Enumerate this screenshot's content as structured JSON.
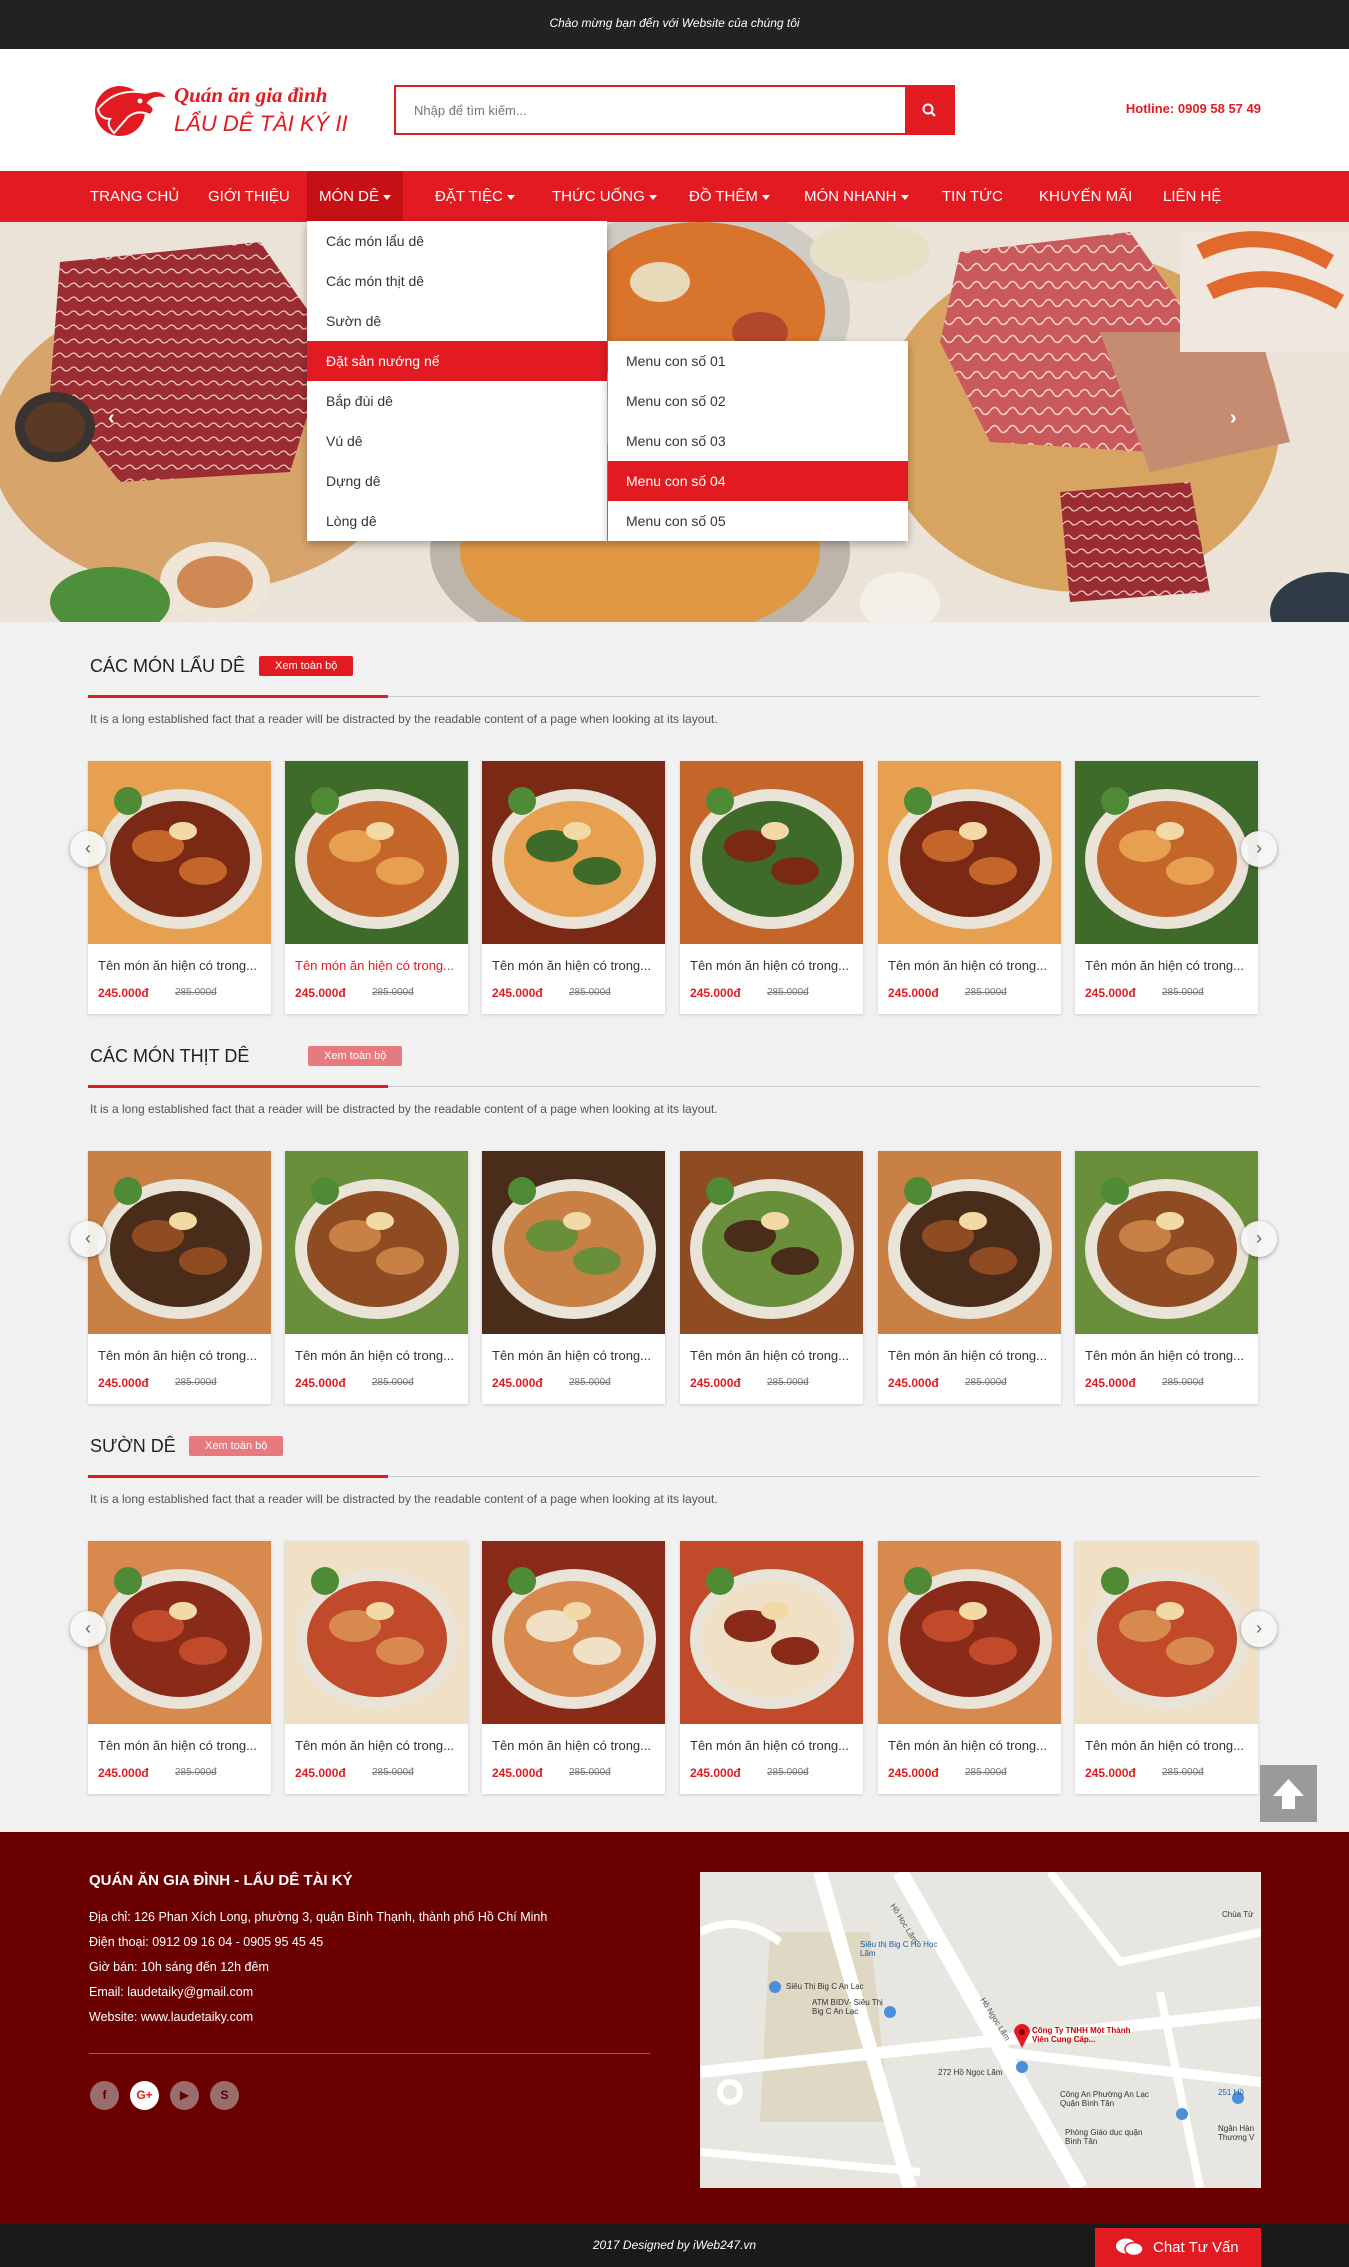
{
  "topbar": {
    "welcome": "Chào mừng bạn đến với Website của chúng tôi"
  },
  "header": {
    "logo_line1": "Quán ăn gia đình",
    "logo_line2": "LẨU DÊ TÀI KÝ II",
    "search_placeholder": "Nhập để tìm kiếm...",
    "hotline_label": "Hotline: 0909 58 57 49"
  },
  "nav": {
    "items": [
      "TRANG CHỦ",
      "GIỚI THIỆU",
      "MÓN DÊ",
      "ĐẶT TIỆC",
      "THỨC UỐNG",
      "ĐỒ THÊM",
      "MÓN NHANH",
      "TIN TỨC",
      "KHUYẾN MÃI",
      "LIÊN HỆ"
    ]
  },
  "dropdown": {
    "items": [
      "Các món lẩu dê",
      "Các món thịt dê",
      "Sườn dê",
      "Đặt sản nướng nế",
      "Bắp đùi dê",
      "Vú dê",
      "Dựng dê",
      "Lòng dê"
    ],
    "sub_items": [
      "Menu con số 01",
      "Menu con số 02",
      "Menu con số 03",
      "Menu con số 04",
      "Menu con số 05"
    ]
  },
  "banner": {
    "prev_arrow": "‹",
    "next_arrow": "›"
  },
  "sections": [
    {
      "title": "CÁC MÓN LẨU DÊ",
      "view_all": "Xem toàn bộ",
      "description": "It is a long established fact that a reader will be distracted by the readable content of a page when looking at its layout."
    },
    {
      "title": "CÁC MÓN THỊT DÊ",
      "view_all": "Xem toàn bộ",
      "description": "It is a long established fact that a reader will be distracted by the readable content of a page when looking at its layout."
    },
    {
      "title": "SƯỜN DÊ",
      "view_all": "Xem toàn bộ",
      "description": "It is a long established fact that a reader will be distracted by the readable content of a page when looking at its layout."
    }
  ],
  "product": {
    "name": "Tên món ăn hiện có trong...",
    "price": "245.000đ",
    "old_price": "285.000đ"
  },
  "footer": {
    "title": "QUÁN ĂN GIA ĐÌNH - LẨU DÊ TÀI KÝ",
    "address": "Địa chỉ: 126 Phan Xích Long, phường 3, quận Bình Thạnh, thành phố Hồ Chí Minh",
    "phone": "Điện thoại: 0912 09 16 04 - 0905 95 45 45",
    "hours": "Giờ bán: 10h sáng đến  12h đêm",
    "email": "Email: laudetaiky@gmail.com",
    "website": "Website: www.laudetaiky.com",
    "social": [
      "f",
      "G+",
      "▶",
      "S"
    ]
  },
  "map": {
    "labels": [
      "Siêu thị Big C Hồ Học Lãm",
      "Siêu Thị Big C An Lạc",
      "ATM BIDV- Siêu Thị Big C An Lạc",
      "Công Ty TNHH Một Thành Viên Cung Cấp...",
      "272 Hồ Ngọc Lãm",
      "Công An Phường An Lạc Quận Bình Tân",
      "Phòng Giáo dục quận Bình Tân",
      "Chùa Từ",
      "251 Hồ",
      "Ngân Hàn Thương V",
      "Hồ Học Lãm",
      "Hồ Ngọc Lãm"
    ]
  },
  "bottombar": {
    "credit": "2017 Designed by iWeb247.vn"
  },
  "chat": {
    "label": "Chat Tư Vấn"
  }
}
